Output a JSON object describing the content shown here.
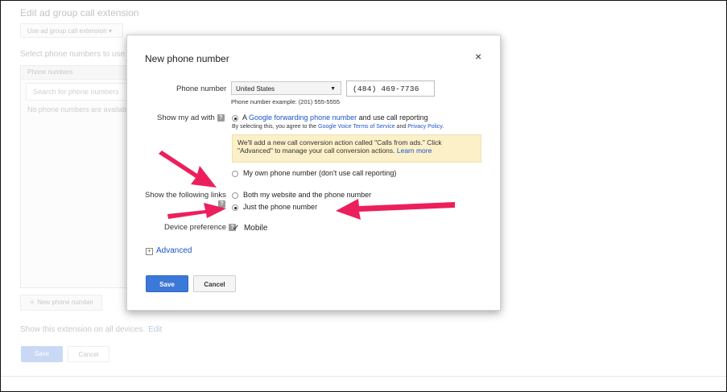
{
  "background": {
    "title": "Edit ad group call extension",
    "extension_dropdown": "Use ad group call extension",
    "select_text": "Select phone numbers to use w",
    "panel_header": "Phone numbers",
    "search_placeholder": "Search for phone numbers",
    "empty_text": "No phone numbers are availab",
    "new_number_button": "New phone number",
    "show_text": "Show this extension on all devices.",
    "edit_link": "Edit",
    "save_button": "Save",
    "cancel_button": "Cancel"
  },
  "dialog": {
    "title": "New phone number",
    "close_symbol": "×",
    "phone_number_label": "Phone number",
    "country": "United States",
    "phone_value": "(484) 469-7736",
    "example": "Phone number example: (201) 555-5555",
    "show_ad_label": "Show my ad with",
    "option_google_prefix": "A ",
    "option_google_link": "Google forwarding phone number",
    "option_google_suffix": " and use call reporting",
    "agree_prefix": "By selecting this, you agree to the ",
    "agree_link1": "Google Voice Terms of Service",
    "agree_mid": " and ",
    "agree_link2": "Privacy Policy",
    "agree_end": ".",
    "notice_text": "We'll add a new call conversion action called \"Calls from ads.\" Click \"Advanced\" to manage your call conversion actions. ",
    "notice_link": "Learn more",
    "option_own": "My own phone number (don't use call reporting)",
    "links_label": "Show the following links",
    "option_both": "Both my website and the phone number",
    "option_just": "Just the phone number",
    "device_label": "Device preference",
    "mobile_checkbox": "Mobile",
    "advanced_link": "Advanced",
    "save_button": "Save",
    "cancel_button": "Cancel"
  },
  "icons": {
    "help": "help-icon",
    "close": "close-icon",
    "expand": "plus-box-icon"
  },
  "colors": {
    "primary_button": "#3c78d8",
    "link": "#1a55c8",
    "notice_bg": "#fcf0c9",
    "annotation_arrow": "#ec1f5c"
  }
}
